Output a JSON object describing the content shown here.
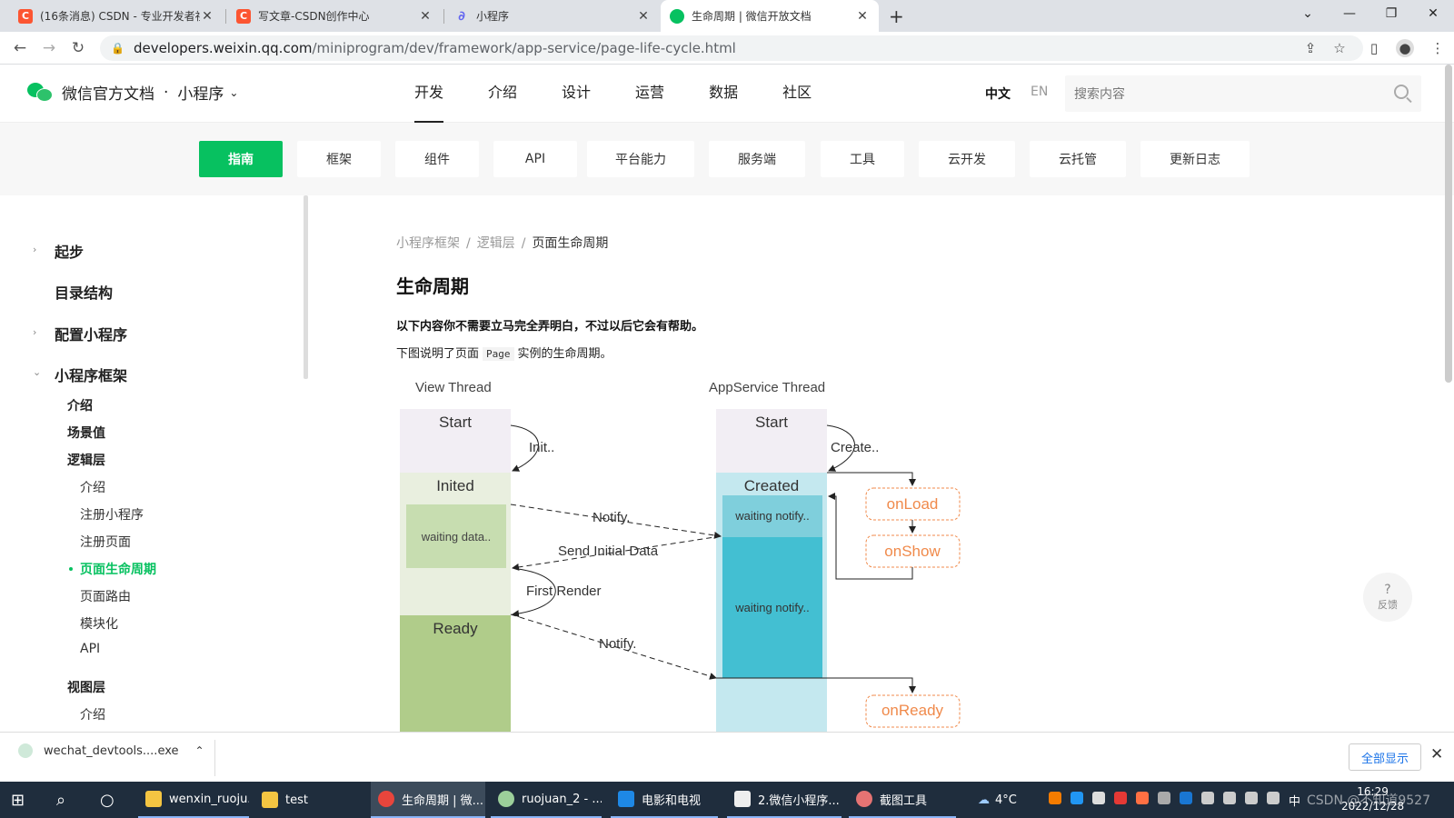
{
  "browser": {
    "tabs": [
      {
        "title": "(16条消息) CSDN - 专业开发者社",
        "icon": "csdn-icon",
        "color": "#fc5531"
      },
      {
        "title": "写文章-CSDN创作中心",
        "icon": "csdn-icon",
        "color": "#fc5531"
      },
      {
        "title": "小程序",
        "icon": "miniprogram-icon",
        "color": "#6467f0"
      },
      {
        "title": "生命周期 | 微信开放文档",
        "icon": "wechat-icon",
        "color": "#07c160"
      }
    ],
    "url_host": "developers.weixin.qq.com",
    "url_path": "/miniprogram/dev/framework/app-service/page-life-cycle.html"
  },
  "site": {
    "logo_text": "微信官方文档",
    "logo_dot": "·",
    "product": "小程序",
    "main_nav": [
      "开发",
      "介绍",
      "设计",
      "运营",
      "数据",
      "社区"
    ],
    "lang_zh": "中文",
    "lang_en": "EN",
    "search_placeholder": "搜索内容",
    "sub_nav": [
      "指南",
      "框架",
      "组件",
      "API",
      "平台能力",
      "服务端",
      "工具",
      "云开发",
      "云托管",
      "更新日志"
    ]
  },
  "sidebar": {
    "l1": [
      "起步",
      "目录结构",
      "配置小程序",
      "小程序框架"
    ],
    "l2": [
      "介绍",
      "场景值",
      "逻辑层",
      "视图层"
    ],
    "l3": [
      "介绍",
      "注册小程序",
      "注册页面",
      "页面生命周期",
      "页面路由",
      "模块化",
      "API"
    ],
    "l3b": [
      "介绍"
    ]
  },
  "content": {
    "breadcrumb": [
      "小程序框架",
      "逻辑层",
      "页面生命周期"
    ],
    "breadcrumb_sep": "/",
    "title": "生命周期",
    "bold_note": "以下内容你不需要立马完全弄明白，不过以后它会有帮助。",
    "desc_before": "下图说明了页面",
    "desc_code": "Page",
    "desc_after": "实例的生命周期。"
  },
  "diagram": {
    "view_thread": "View Thread",
    "app_thread": "AppService Thread",
    "start": "Start",
    "inited": "Inited",
    "ready": "Ready",
    "waiting_data": "waiting data..",
    "created": "Created",
    "waiting_notify": "waiting notify..",
    "init": "Init..",
    "create": "Create..",
    "notify": "Notify.",
    "send_initial": "Send Initial Data",
    "first_render": "First Render",
    "onload": "onLoad",
    "onshow": "onShow",
    "onready": "onReady"
  },
  "feedback": {
    "q": "?",
    "label": "反馈"
  },
  "download": {
    "file": "wechat_devtools....exe",
    "show_all": "全部显示"
  },
  "taskbar": {
    "items": [
      "wenxin_ruoju...",
      "test",
      "生命周期 | 微...",
      "ruojuan_2 - ...",
      "电影和电视",
      "2.微信小程序...",
      "截图工具"
    ],
    "weather": "4°C",
    "ime": "中",
    "time": "16:29",
    "date": "2022/12/28",
    "watermark": "CSDN @不知道9527"
  }
}
